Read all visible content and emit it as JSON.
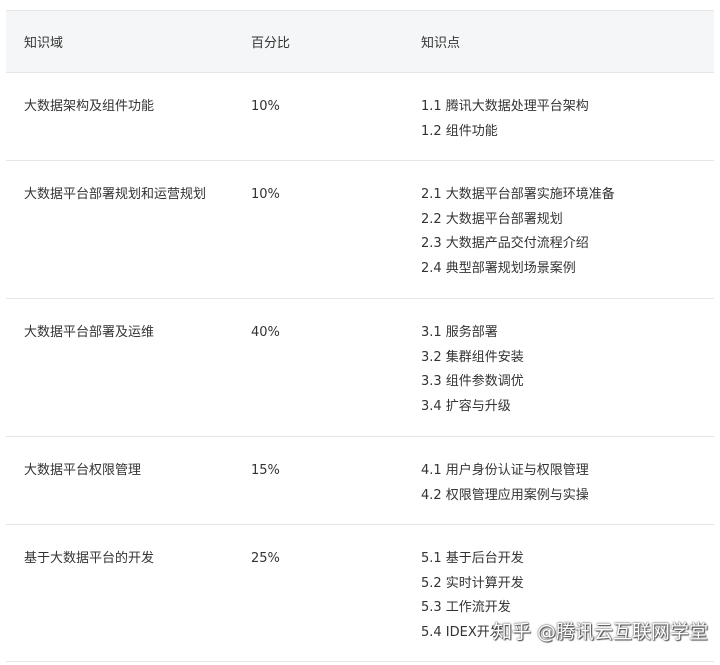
{
  "table": {
    "headers": [
      "知识域",
      "百分比",
      "知识点"
    ],
    "rows": [
      {
        "domain": "大数据架构及组件功能",
        "percent": "10%",
        "points": [
          "1.1 腾讯大数据处理平台架构",
          "1.2 组件功能"
        ]
      },
      {
        "domain": "大数据平台部署规划和运营规划",
        "percent": "10%",
        "points": [
          "2.1 大数据平台部署实施环境准备",
          "2.2 大数据平台部署规划",
          "2.3 大数据产品交付流程介绍",
          "2.4 典型部署规划场景案例"
        ]
      },
      {
        "domain": "大数据平台部署及运维",
        "percent": "40%",
        "points": [
          "3.1 服务部署",
          "3.2 集群组件安装",
          "3.3 组件参数调优",
          "3.4 扩容与升级"
        ]
      },
      {
        "domain": "大数据平台权限管理",
        "percent": "15%",
        "points": [
          "4.1 用户身份认证与权限管理",
          "4.2 权限管理应用案例与实操"
        ]
      },
      {
        "domain": "基于大数据平台的开发",
        "percent": "25%",
        "points": [
          "5.1 基于后台开发",
          "5.2 实时计算开发",
          "5.3 工作流开发",
          "5.4 IDEX开发"
        ]
      }
    ]
  },
  "watermark": "知乎 @腾讯云互联网学堂"
}
